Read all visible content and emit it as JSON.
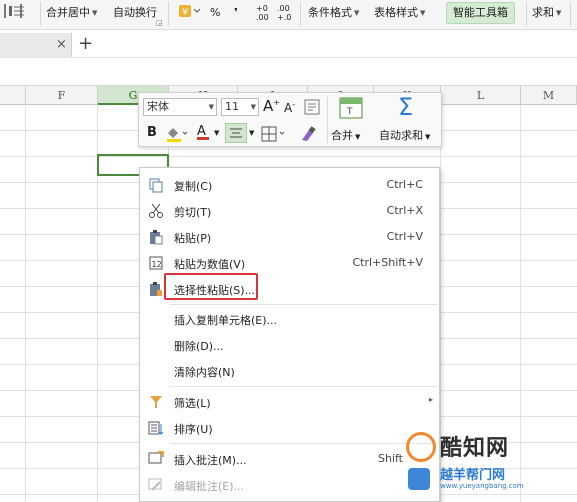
{
  "ribbon": {
    "merge_center": "合并居中",
    "auto_wrap": "自动换行",
    "percent": "%",
    "thousands": "❜",
    "inc_decimal_top": "+0",
    "inc_decimal_bottom": ".00",
    "dec_decimal_top": ".00",
    "dec_decimal_bottom": "+.0",
    "conditional_format": "条件格式",
    "table_style": "表格样式",
    "smart_toolbox": "智能工具箱",
    "sum": "求和"
  },
  "tabbar": {
    "close": "×",
    "add": "+"
  },
  "columns": [
    "F",
    "G",
    "H",
    "I",
    "J",
    "K",
    "L",
    "M"
  ],
  "mini_toolbar": {
    "font_name": "宋体",
    "font_size": "11",
    "grow_font": "A",
    "shrink_font": "A",
    "bold": "B",
    "font_color": "A",
    "merge": "合并",
    "autosum": "自动求和",
    "sigma": "Σ"
  },
  "context_menu": {
    "items": [
      {
        "label": "复制(C)",
        "shortcut": "Ctrl+C",
        "icon": "copy-icon"
      },
      {
        "label": "剪切(T)",
        "shortcut": "Ctrl+X",
        "icon": "scissors-icon"
      },
      {
        "label": "粘贴(P)",
        "shortcut": "Ctrl+V",
        "icon": "paste-icon"
      },
      {
        "label": "粘贴为数值(V)",
        "shortcut": "Ctrl+Shift+V",
        "icon": "paste-values-icon"
      },
      {
        "label": "选择性粘贴(S)...",
        "shortcut": "",
        "icon": "paste-special-icon"
      },
      {
        "label": "插入复制单元格(E)...",
        "shortcut": "",
        "icon": ""
      },
      {
        "label": "删除(D)...",
        "shortcut": "",
        "icon": ""
      },
      {
        "label": "清除内容(N)",
        "shortcut": "",
        "icon": ""
      },
      {
        "label": "筛选(L)",
        "shortcut": "",
        "icon": "filter-icon"
      },
      {
        "label": "排序(U)",
        "shortcut": "",
        "icon": "sort-icon"
      },
      {
        "label": "插入批注(M)...",
        "shortcut": "Shift",
        "icon": "comment-icon"
      },
      {
        "label": "编辑批注(E)...",
        "shortcut": "",
        "icon": "edit-comment-icon"
      }
    ]
  },
  "watermark": {
    "title": "酷知网",
    "sub": "越羊帮门网",
    "url": "www.yueyangbang.com"
  },
  "colors": {
    "accent_green": "#4a8a3a",
    "highlight_red": "#d9343a",
    "font_color_red": "#d03a2c"
  }
}
